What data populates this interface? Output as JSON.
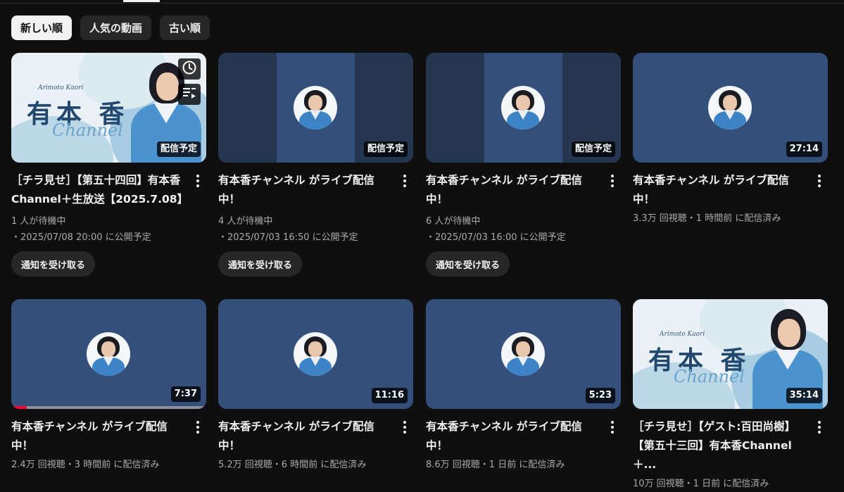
{
  "chips": [
    "新しい順",
    "人気の動画",
    "古い順"
  ],
  "selected_chip": "新しい順",
  "videos": [
    {
      "title": "［チラ見せ］【第五十四回】有本香Channel＋生放送【2025.7.08】",
      "badge": "配信予定",
      "line1": "1 人が待機中",
      "line2": "・2025/07/08 20:00 に公開予定",
      "notify": "通知を受け取る",
      "art": {
        "small": "Arimoto Kaori",
        "big": "有本 香",
        "script": "Channel"
      }
    },
    {
      "title": "有本香チャンネル がライブ配信中！",
      "badge": "配信予定",
      "line1": "4 人が待機中",
      "line2": "・2025/07/03 16:50 に公開予定",
      "notify": "通知を受け取る"
    },
    {
      "title": "有本香チャンネル がライブ配信中！",
      "badge": "配信予定",
      "line1": "6 人が待機中",
      "line2": "・2025/07/03 16:00 に公開予定",
      "notify": "通知を受け取る"
    },
    {
      "title": "有本香チャンネル がライブ配信中！",
      "badge": "27:14",
      "line1": "3.3万 回視聴・1 時間前 に配信済み"
    },
    {
      "title": "有本香チャンネル がライブ配信中！",
      "badge": "7:37",
      "line1": "2.4万 回視聴・3 時間前 に配信済み",
      "watched_fraction": 0.08
    },
    {
      "title": "有本香チャンネル がライブ配信中！",
      "badge": "11:16",
      "line1": "5.2万 回視聴・6 時間前 に配信済み"
    },
    {
      "title": "有本香チャンネル がライブ配信中！",
      "badge": "5:23",
      "line1": "8.6万 回視聴・1 日前 に配信済み"
    },
    {
      "title": "［チラ見せ］【ゲスト:百田尚樹】【第五十三回】有本香Channel＋...",
      "badge": "35:14",
      "line1": "10万 回視聴・1 日前 に配信済み",
      "art": {
        "small": "Arimoto Kaori",
        "big": "有本 香",
        "script": "Channel"
      }
    }
  ],
  "colors": {
    "background": "#0f0f0f",
    "chip": "#272727",
    "chip_selected": "#f1f1f1",
    "thumb_blue": "#34507a",
    "thumb_dark": "#253650",
    "progress_red": "#ff0033"
  }
}
